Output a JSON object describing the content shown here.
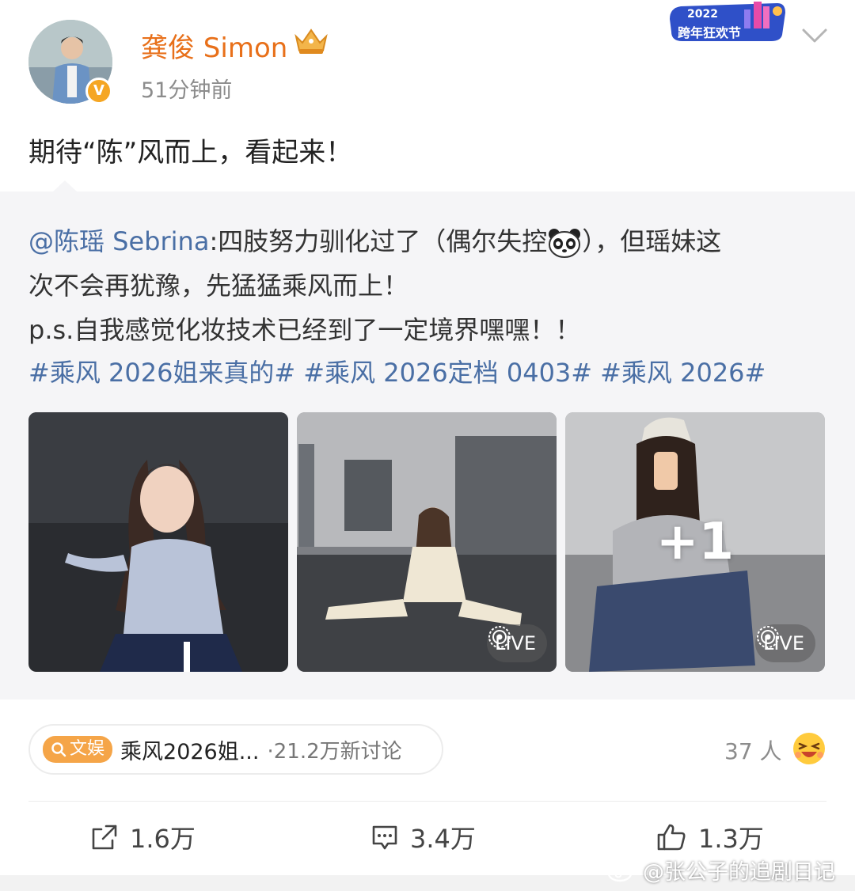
{
  "post": {
    "author_name": "龚俊 Simon",
    "time_ago": "51分钟前",
    "verified_badge_text": "V",
    "promo_badge": {
      "year": "2022",
      "label": "跨年狂欢节"
    },
    "text": "期待“陈”风而上，看起来！"
  },
  "repost": {
    "mention": "@陈瑶 Sebrina",
    "line1_rest": ":四肢努力驯化过了（偶尔失控",
    "line1_tail": "），但瑶妹这",
    "line2": "次不会再犹豫，先猛猛乘风而上！",
    "line3": "p.s.自我感觉化妆技术已经到了一定境界嘿嘿！！",
    "hashtags": [
      "#乘风 2026姐来真的#",
      "#乘风 2026定档 0403#",
      "#乘风 2026#"
    ],
    "photos": [
      {
        "name": "photo-1"
      },
      {
        "name": "photo-2",
        "badge": "LIVE"
      },
      {
        "name": "photo-3",
        "badge": "LIVE",
        "overlay": "+1"
      }
    ]
  },
  "topic": {
    "tag": "文娱",
    "title": "乘风2026姐...",
    "discussion": "·21.2万新讨论"
  },
  "reactions": {
    "people": "37 人",
    "icon": "laughing-emoji-icon"
  },
  "actions": {
    "share": {
      "label": "1.6万",
      "icon": "share-icon"
    },
    "comment": {
      "label": "3.4万",
      "icon": "comment-icon"
    },
    "like": {
      "label": "1.3万",
      "icon": "thumbs-up-icon"
    }
  },
  "watermark": "@张公子的追剧日记",
  "colors": {
    "author": "#e8701a",
    "link": "#4a6fa5",
    "topic_tag": "#f5a548",
    "repost_bg": "#f5f5f7"
  }
}
